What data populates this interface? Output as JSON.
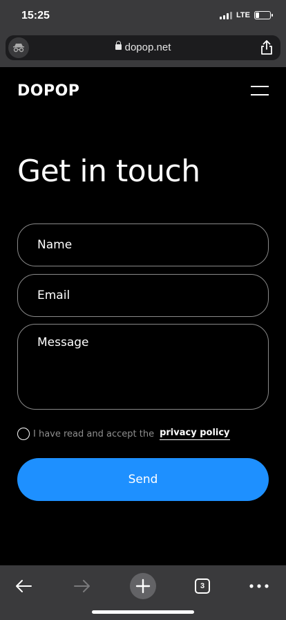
{
  "status": {
    "time": "15:25",
    "network": "LTE",
    "battery_level": 0.25
  },
  "browser": {
    "url": "dopop.net",
    "tabs_count": "3"
  },
  "site": {
    "logo": "DOPOP"
  },
  "page": {
    "title": "Get in touch",
    "form": {
      "name_placeholder": "Name",
      "email_placeholder": "Email",
      "message_placeholder": "Message",
      "consent_text": "I have read and accept the",
      "consent_link": "privacy policy",
      "submit_label": "Send"
    }
  },
  "colors": {
    "accent": "#1e90ff",
    "background": "#000000",
    "chrome": "#3a3a3c"
  },
  "icons": [
    "incognito-icon",
    "lock-icon",
    "share-icon",
    "menu-icon",
    "back-icon",
    "forward-icon",
    "new-tab-icon",
    "tabs-icon",
    "more-icon"
  ]
}
